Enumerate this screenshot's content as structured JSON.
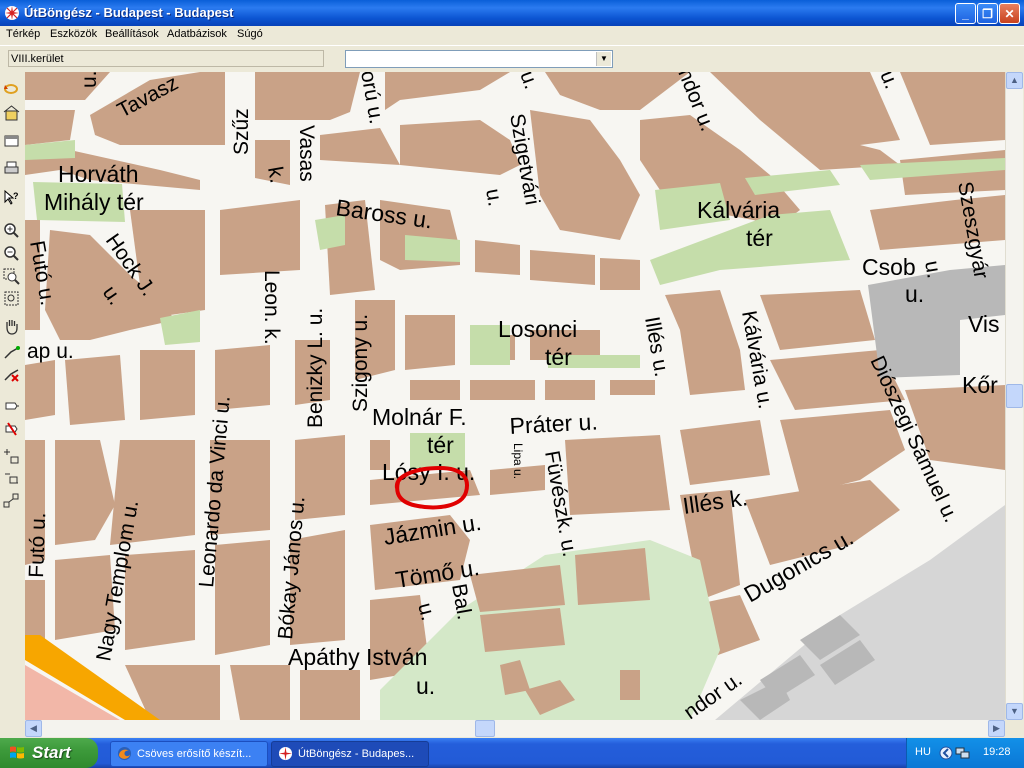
{
  "window": {
    "title": "ÚtBöngész - Budapest - Budapest",
    "buttons": {
      "minimize": "_",
      "maximize": "❐",
      "close": "✕"
    }
  },
  "menu": [
    "Térkép",
    "Eszközök",
    "Beállítások",
    "Adatbázisok",
    "Súgó"
  ],
  "toolbar": {
    "district_value": "VIII.kerület",
    "street_select_value": ""
  },
  "palette_tools": [
    "undo-icon",
    "home-icon",
    "layers-icon",
    "print-icon",
    "help-cursor-icon",
    "zoom-in-icon",
    "zoom-out-icon",
    "zoom-window-icon",
    "zoom-extent-icon",
    "pan-hand-icon",
    "route-icon",
    "route-clear-icon",
    "select-icon",
    "clear-icon",
    "add-point-icon",
    "measure-icon",
    "connect-icon"
  ],
  "map": {
    "colors": {
      "block": "#C9A287",
      "road": "#F7F6F2",
      "park": "#C5DDAA",
      "grey_area": "#B8B8B8",
      "light_green": "#D4E8C8",
      "tram": "#F7A600",
      "pink": "#F2B7A8",
      "annotation": "#E00000"
    },
    "labels": {
      "tavasz": "Tavasz",
      "szuz": "Szűz",
      "u1": "u.",
      "oru": "orú u.",
      "u_top": "u.",
      "ndor": "ndor u.",
      "u_tr": "u.",
      "horvath1": "Horváth",
      "horvath2": "Mihály tér",
      "vasas": "Vasas",
      "k1": "k.",
      "baross": "Baross u.",
      "szigetvari": "Szigetvári",
      "u2": "u.",
      "kalvaria1": "Kálvária",
      "kalvaria2": "tér",
      "szeszgyar": "Szeszgyár",
      "futo1": "Futó u.",
      "hock": "Hock J.",
      "u3": "u.",
      "leon": "Leon. k.",
      "benizky": "Benizky L. u.",
      "szigony": "Szigony u.",
      "losonci1": "Losonci",
      "losonci2": "tér",
      "illes": "Illés u.",
      "kalvaria_u": "Kálvária u.",
      "csob": "Csob",
      "u4": "u.",
      "u5": "u.",
      "vis": "Vis",
      "kor": "Kőr",
      "ap": "ap u.",
      "vinci": "Leonardo da Vinci u.",
      "molnar1": "Molnár F.",
      "molnar2": "tér",
      "prater": "Práter u.",
      "dioszegi": "Diószegi Sámuel u.",
      "losy": "Lósy I. u.",
      "lipa": "Lipa u.",
      "fuvesz": "Füvészk. u.",
      "illes_k": "Illés k.",
      "futo2": "Futó u.",
      "nagy": "Nagy Templom u.",
      "bokay": "Bókay János u.",
      "jazmin": "Jázmin u.",
      "dugonics": "Dugonics u.",
      "tomo": "Tömő u.",
      "bal": "Bal.",
      "u6": "u.",
      "apathy1": "Apáthy István",
      "apathy2": "u.",
      "ndor2": "ndor u."
    }
  },
  "taskbar": {
    "start_label": "Start",
    "tasks": [
      {
        "label": "Csöves erősítő készít...",
        "active": false
      },
      {
        "label": "ÚtBöngész - Budapes...",
        "active": true
      }
    ],
    "tray": {
      "language": "HU",
      "clock": "19:28"
    }
  }
}
